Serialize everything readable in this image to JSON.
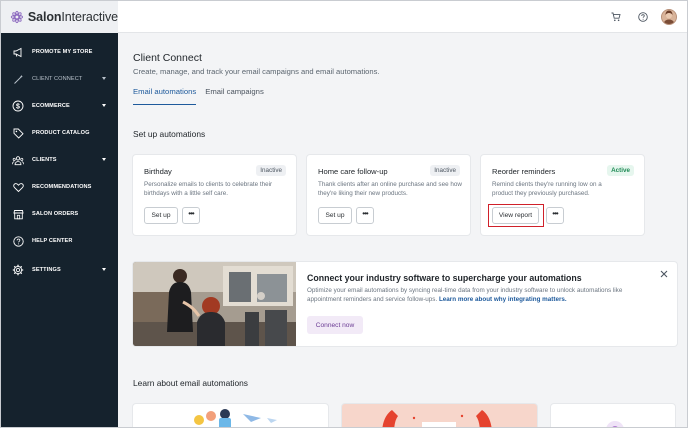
{
  "brand": {
    "name_bold": "Salon",
    "name_rest": "Interactive"
  },
  "topbar": {
    "icons": [
      "cart-icon",
      "help-icon",
      "avatar"
    ]
  },
  "sidebar": {
    "items": [
      {
        "label": "PROMOTE MY STORE",
        "icon": "megaphone-icon",
        "caret": false
      },
      {
        "label": "CLIENT CONNECT",
        "icon": "wand-icon",
        "caret": true,
        "selected": true
      },
      {
        "label": "ECOMMERCE",
        "icon": "dollar-icon",
        "caret": true
      },
      {
        "label": "PRODUCT CATALOG",
        "icon": "tag-icon",
        "caret": false
      },
      {
        "label": "CLIENTS",
        "icon": "people-icon",
        "caret": true
      },
      {
        "label": "RECOMMENDATIONS",
        "icon": "heart-icon",
        "caret": false
      },
      {
        "label": "SALON ORDERS",
        "icon": "store-icon",
        "caret": false
      },
      {
        "label": "HELP CENTER",
        "icon": "help-icon",
        "caret": false
      },
      {
        "label": "SETTINGS",
        "icon": "gear-icon",
        "caret": true
      }
    ]
  },
  "page": {
    "title": "Client Connect",
    "subtitle": "Create, manage, and track your email campaigns and email automations.",
    "tabs": [
      {
        "label": "Email automations",
        "active": true
      },
      {
        "label": "Email campaigns",
        "active": false
      }
    ]
  },
  "setup": {
    "title": "Set up automations",
    "cards": [
      {
        "title": "Birthday",
        "status": "Inactive",
        "desc": "Personalize emails to clients to celebrate their birthdays with a little self care.",
        "button": "Set up"
      },
      {
        "title": "Home care follow-up",
        "status": "Inactive",
        "desc": "Thank clients after an online purchase and see how they're liking their new products.",
        "button": "Set up"
      },
      {
        "title": "Reorder reminders",
        "status": "Active",
        "desc": "Remind clients they're running low on a product they previously purchased.",
        "button": "View report"
      }
    ],
    "more_label": "•••"
  },
  "banner": {
    "title": "Connect your industry software to supercharge your automations",
    "text": "Optimize your email automations by syncing real-time data from your industry software to unlock automations like appointment reminders and service follow-ups. ",
    "link": "Learn more about why integrating matters.",
    "button": "Connect now"
  },
  "learn": {
    "title": "Learn about email automations"
  },
  "colors": {
    "sidebar": "#15222d",
    "accent": "#1e5a9c",
    "active_badge": "#1f8a55",
    "highlight": "#d0202a"
  }
}
